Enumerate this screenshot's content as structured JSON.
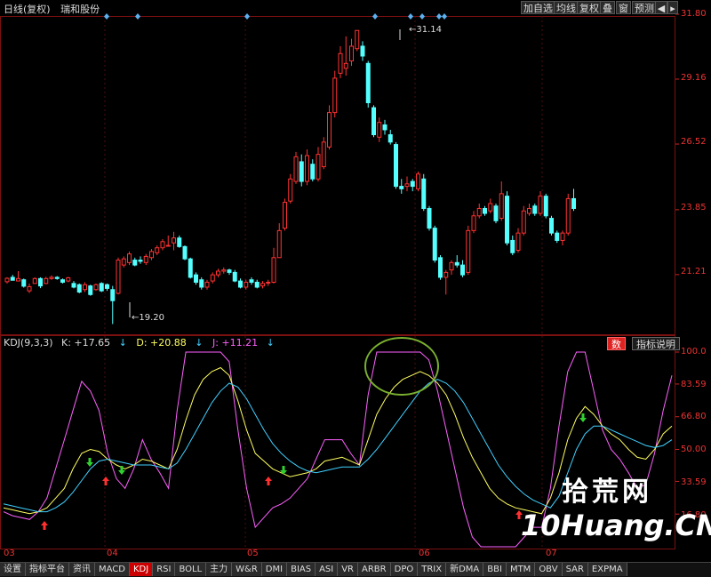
{
  "header": {
    "period": "日线(复权)",
    "stock_name": "瑞和股份",
    "buttons": [
      "加自选",
      "均线",
      "复权",
      "叠",
      "窗",
      "预测"
    ],
    "nav_left_icon": "prev-arrow-icon",
    "nav_right_icon": "next-arrow-icon"
  },
  "price_axis": {
    "labels": [
      "31.80",
      "29.16",
      "26.52",
      "23.85",
      "21.21"
    ],
    "values": [
      31.8,
      29.16,
      26.52,
      23.85,
      21.21
    ]
  },
  "annotations": {
    "high_label": "31.14",
    "low_label": "19.20"
  },
  "kdj_panel": {
    "name": "KDJ(9,3,3)",
    "k_label": "K: +17.65",
    "d_label": "D: +20.88",
    "j_label": "J: +11.21",
    "btn_num": "数",
    "btn_explain": "指标说明",
    "axis_labels": [
      "100.0",
      "83.59",
      "66.80",
      "50.00",
      "33.59",
      "16.80"
    ],
    "axis_values": [
      100.0,
      83.59,
      66.8,
      50.0,
      33.59,
      16.8
    ]
  },
  "x_labels": [
    "03",
    "04",
    "05",
    "06",
    "07"
  ],
  "tabs": [
    "设置",
    "指标平台",
    "资讯",
    "MACD",
    "KDJ",
    "RSI",
    "BOLL",
    "主力",
    "W&R",
    "DMI",
    "BIAS",
    "ASI",
    "VR",
    "ARBR",
    "DPO",
    "TRIX",
    "新DMA",
    "BBI",
    "MTM",
    "OBV",
    "SAR",
    "EXPMA"
  ],
  "active_tab": "KDJ",
  "watermark": {
    "line1": "拾荒网",
    "line2": "10Huang.CN"
  },
  "colors": {
    "up": "#ff3232",
    "down": "#54ffff",
    "k_line": "#ffffff",
    "d_line": "#ffff60",
    "j_line": "#ff60ff",
    "d_curve": "#40d0ff",
    "highlight_circle": "#7ab030",
    "buy_arrow": "#ff3030",
    "sell_arrow": "#30d030"
  },
  "chart_data": {
    "type": "candlestick",
    "candles": [
      [
        20.92,
        21.06,
        20.85,
        21.1
      ],
      [
        21.1,
        20.98,
        21.05,
        21.2
      ],
      [
        20.95,
        21.05,
        21.0,
        21.35
      ],
      [
        21.0,
        20.74,
        20.68,
        21.05
      ],
      [
        20.55,
        20.72,
        20.46,
        20.85
      ],
      [
        20.85,
        21.05,
        20.88,
        21.1
      ],
      [
        21.05,
        20.75,
        20.66,
        21.1
      ],
      [
        20.85,
        21.05,
        20.82,
        21.12
      ],
      [
        21.05,
        21.1,
        21.0,
        21.18
      ],
      [
        21.1,
        21.05,
        21.0,
        21.15
      ],
      [
        21.0,
        20.9,
        20.85,
        21.05
      ],
      [
        20.95,
        21.08,
        20.9,
        21.12
      ],
      [
        20.85,
        20.7,
        20.65,
        20.95
      ],
      [
        20.8,
        20.5,
        20.45,
        20.85
      ],
      [
        20.6,
        20.8,
        20.5,
        20.9
      ],
      [
        20.75,
        20.4,
        20.35,
        20.8
      ],
      [
        20.6,
        20.8,
        20.55,
        20.85
      ],
      [
        20.85,
        20.55,
        20.5,
        20.9
      ],
      [
        20.8,
        20.65,
        20.55,
        20.85
      ],
      [
        20.6,
        20.15,
        19.2,
        20.75
      ],
      [
        20.45,
        21.8,
        20.4,
        21.9
      ],
      [
        21.6,
        21.85,
        21.5,
        21.95
      ],
      [
        21.7,
        22.05,
        21.6,
        22.15
      ],
      [
        21.8,
        21.6,
        21.55,
        21.9
      ],
      [
        21.8,
        21.75,
        21.65,
        21.95
      ],
      [
        21.7,
        21.95,
        21.6,
        22.05
      ],
      [
        21.9,
        22.15,
        21.8,
        22.25
      ],
      [
        22.1,
        22.3,
        22.0,
        22.4
      ],
      [
        22.3,
        22.55,
        22.2,
        22.65
      ],
      [
        22.4,
        22.4,
        22.35,
        22.8
      ],
      [
        22.5,
        22.7,
        22.2,
        22.95
      ],
      [
        22.7,
        22.35,
        22.3,
        22.8
      ],
      [
        22.35,
        21.85,
        21.8,
        22.4
      ],
      [
        21.85,
        21.1,
        21.05,
        21.9
      ],
      [
        21.2,
        20.9,
        20.8,
        21.3
      ],
      [
        21.0,
        20.7,
        20.6,
        21.1
      ],
      [
        20.7,
        20.9,
        20.6,
        21.0
      ],
      [
        20.95,
        21.2,
        20.85,
        21.3
      ],
      [
        21.2,
        21.35,
        21.1,
        21.45
      ],
      [
        21.35,
        21.4,
        21.25,
        21.5
      ],
      [
        21.4,
        21.3,
        21.2,
        21.45
      ],
      [
        21.3,
        20.95,
        20.9,
        21.4
      ],
      [
        20.95,
        20.7,
        20.65,
        21.05
      ],
      [
        20.7,
        20.9,
        20.6,
        21.0
      ],
      [
        21.0,
        20.9,
        20.8,
        21.1
      ],
      [
        20.9,
        20.7,
        20.65,
        21.0
      ],
      [
        20.75,
        20.85,
        20.65,
        20.95
      ],
      [
        20.9,
        20.9,
        20.75,
        21.0
      ],
      [
        20.9,
        21.9,
        20.85,
        22.3
      ],
      [
        21.9,
        23.0,
        21.9,
        23.3
      ],
      [
        23.1,
        24.15,
        23.0,
        24.3
      ],
      [
        24.2,
        25.1,
        24.1,
        25.3
      ],
      [
        25.0,
        26.0,
        24.9,
        26.2
      ],
      [
        25.8,
        25.0,
        24.8,
        26.1
      ],
      [
        25.0,
        26.05,
        24.85,
        26.3
      ],
      [
        25.7,
        25.1,
        25.0,
        25.9
      ],
      [
        25.1,
        26.1,
        25.0,
        26.4
      ],
      [
        25.6,
        26.6,
        25.5,
        26.8
      ],
      [
        26.4,
        27.8,
        26.3,
        28.1
      ],
      [
        27.8,
        29.2,
        27.6,
        29.5
      ],
      [
        29.4,
        30.2,
        29.2,
        30.5
      ],
      [
        29.6,
        29.8,
        29.3,
        30.9
      ],
      [
        29.9,
        30.5,
        29.7,
        30.8
      ],
      [
        30.4,
        31.14,
        30.3,
        31.14
      ],
      [
        30.5,
        30.1,
        29.9,
        30.7
      ],
      [
        29.8,
        28.2,
        28.0,
        29.9
      ],
      [
        28.0,
        26.9,
        26.8,
        28.1
      ],
      [
        26.8,
        27.4,
        26.6,
        27.6
      ],
      [
        27.3,
        27.1,
        26.9,
        27.5
      ],
      [
        26.9,
        26.6,
        26.5,
        27.1
      ],
      [
        26.5,
        24.8,
        24.7,
        26.6
      ],
      [
        24.8,
        24.7,
        24.5,
        25.1
      ],
      [
        24.8,
        24.9,
        24.6,
        25.2
      ],
      [
        25.0,
        24.8,
        24.6,
        25.1
      ],
      [
        24.7,
        25.3,
        24.6,
        25.4
      ],
      [
        25.1,
        23.9,
        23.8,
        25.3
      ],
      [
        23.9,
        23.1,
        23.0,
        24.0
      ],
      [
        23.1,
        21.8,
        21.7,
        23.2
      ],
      [
        21.9,
        21.1,
        21.0,
        22.0
      ],
      [
        21.1,
        21.3,
        20.4,
        21.4
      ],
      [
        21.4,
        21.7,
        21.2,
        21.8
      ],
      [
        21.7,
        21.6,
        21.5,
        22.0
      ],
      [
        21.6,
        21.2,
        21.1,
        21.8
      ],
      [
        21.3,
        23.0,
        21.2,
        23.2
      ],
      [
        23.0,
        23.6,
        22.9,
        23.8
      ],
      [
        23.6,
        23.9,
        23.5,
        24.1
      ],
      [
        23.9,
        23.7,
        23.6,
        24.0
      ],
      [
        23.8,
        24.1,
        23.7,
        24.3
      ],
      [
        24.0,
        23.4,
        23.3,
        24.1
      ],
      [
        23.5,
        24.5,
        23.4,
        25.0
      ],
      [
        24.4,
        22.5,
        22.4,
        24.6
      ],
      [
        22.6,
        22.1,
        22.0,
        22.8
      ],
      [
        22.2,
        22.9,
        22.1,
        23.1
      ],
      [
        22.9,
        23.8,
        22.8,
        24.0
      ],
      [
        23.7,
        23.9,
        23.6,
        24.1
      ],
      [
        24.0,
        23.7,
        23.6,
        24.1
      ],
      [
        23.7,
        24.4,
        23.6,
        24.6
      ],
      [
        24.4,
        23.6,
        23.5,
        24.5
      ],
      [
        23.5,
        22.9,
        22.8,
        23.6
      ],
      [
        22.9,
        22.6,
        22.5,
        23.0
      ],
      [
        22.6,
        22.9,
        22.4,
        23.0
      ],
      [
        22.9,
        24.3,
        22.8,
        24.5
      ],
      [
        24.3,
        23.9,
        23.8,
        24.7
      ]
    ],
    "kdj": {
      "k": [
        20,
        19,
        18,
        17,
        18,
        20,
        25,
        30,
        40,
        48,
        50,
        49,
        45,
        42,
        40,
        42,
        45,
        44,
        42,
        40,
        50,
        65,
        78,
        86,
        90,
        92,
        88,
        75,
        60,
        48,
        44,
        40,
        38,
        36,
        37,
        38,
        40,
        44,
        45,
        46,
        44,
        42,
        55,
        68,
        76,
        82,
        86,
        88,
        90,
        88,
        84,
        78,
        68,
        56,
        46,
        38,
        30,
        25,
        22,
        20,
        19,
        18,
        17,
        25,
        38,
        55,
        66,
        72,
        68,
        62,
        58,
        55,
        50,
        46,
        45,
        50,
        58,
        62
      ],
      "d": [
        22,
        21,
        20,
        19,
        18,
        18,
        20,
        23,
        28,
        34,
        40,
        44,
        45,
        44,
        43,
        42,
        42,
        42,
        41,
        40,
        43,
        50,
        58,
        66,
        74,
        80,
        84,
        82,
        76,
        68,
        60,
        53,
        48,
        44,
        41,
        39,
        38,
        39,
        40,
        41,
        41,
        41,
        45,
        50,
        56,
        62,
        68,
        74,
        80,
        84,
        86,
        84,
        80,
        74,
        66,
        58,
        50,
        42,
        36,
        31,
        27,
        24,
        22,
        20,
        26,
        38,
        50,
        58,
        62,
        62,
        60,
        58,
        56,
        54,
        52,
        51,
        52,
        55
      ],
      "j": [
        18,
        16,
        15,
        14,
        18,
        25,
        40,
        55,
        70,
        85,
        80,
        70,
        48,
        35,
        30,
        40,
        55,
        45,
        38,
        30,
        70,
        100,
        100,
        100,
        100,
        100,
        95,
        60,
        30,
        10,
        15,
        20,
        22,
        25,
        30,
        35,
        45,
        55,
        55,
        55,
        48,
        42,
        78,
        100,
        100,
        100,
        100,
        100,
        100,
        96,
        80,
        60,
        40,
        20,
        5,
        0,
        0,
        0,
        0,
        0,
        5,
        10,
        10,
        30,
        62,
        90,
        100,
        100,
        80,
        60,
        50,
        45,
        38,
        30,
        32,
        48,
        70,
        88
      ]
    }
  }
}
